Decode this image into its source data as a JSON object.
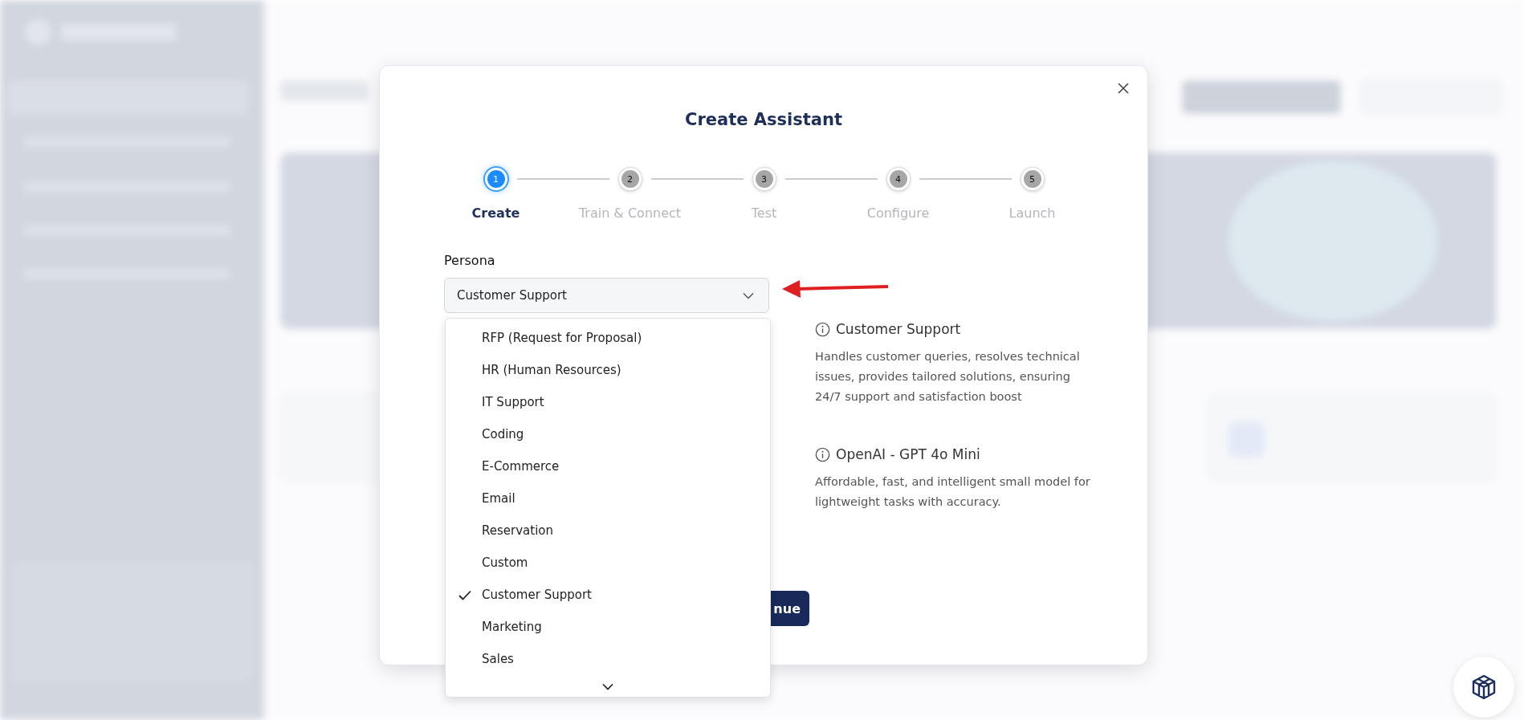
{
  "dialog": {
    "title": "Create Assistant"
  },
  "steps": [
    {
      "number": "1",
      "label": "Create",
      "selected": true
    },
    {
      "number": "2",
      "label": "Train & Connect",
      "selected": false
    },
    {
      "number": "3",
      "label": "Test",
      "selected": false
    },
    {
      "number": "4",
      "label": "Configure",
      "selected": false
    },
    {
      "number": "5",
      "label": "Launch",
      "selected": false
    }
  ],
  "persona": {
    "label": "Persona",
    "value": "Customer Support",
    "expanded": true,
    "options": [
      {
        "label": "RFP (Request for Proposal)",
        "selected": false
      },
      {
        "label": "HR (Human Resources)",
        "selected": false
      },
      {
        "label": "IT Support",
        "selected": false
      },
      {
        "label": "Coding",
        "selected": false
      },
      {
        "label": "E-Commerce",
        "selected": false
      },
      {
        "label": "Email",
        "selected": false
      },
      {
        "label": "Reservation",
        "selected": false
      },
      {
        "label": "Custom",
        "selected": false
      },
      {
        "label": "Customer Support",
        "selected": true
      },
      {
        "label": "Marketing",
        "selected": false
      },
      {
        "label": "Sales",
        "selected": false
      }
    ]
  },
  "info": [
    {
      "title": "Customer Support",
      "description": "Handles customer queries, resolves technical issues, provides tailored solutions, ensuring 24/7 support and satisfaction boost"
    },
    {
      "title": "OpenAI - GPT 4o Mini",
      "description": "Affordable, fast, and intelligent small model for lightweight tasks with accuracy."
    }
  ],
  "continue_button": {
    "label": "nue"
  }
}
